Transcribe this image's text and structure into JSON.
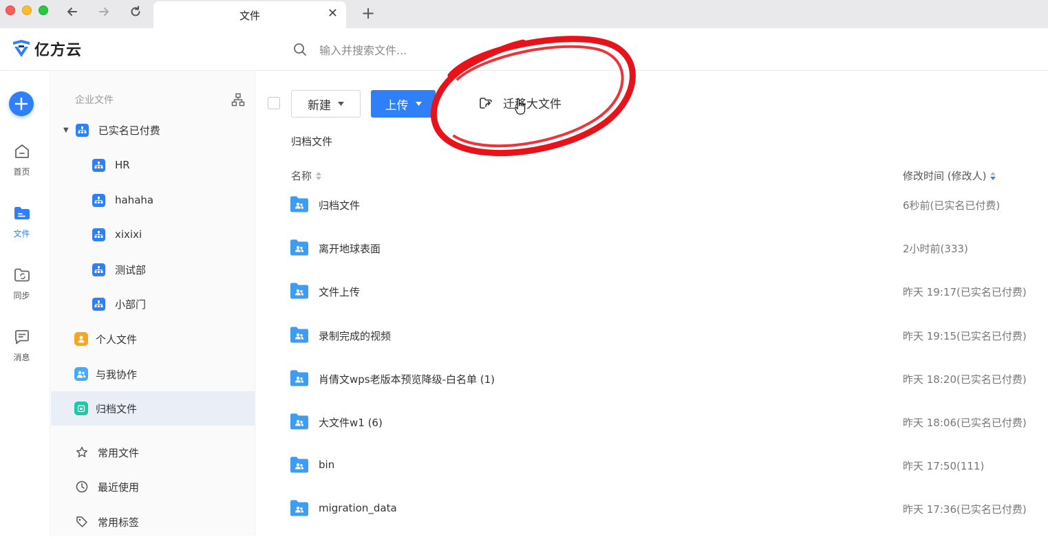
{
  "browser": {
    "tab_title": "文件",
    "close_glyph": "✕",
    "new_tab_glyph": "+"
  },
  "header": {
    "logo_text": "亿方云",
    "search_placeholder": "输入并搜索文件..."
  },
  "rail": {
    "items": [
      {
        "label": "首页",
        "icon": "home-icon"
      },
      {
        "label": "文件",
        "icon": "folder-icon",
        "active": true
      },
      {
        "label": "同步",
        "icon": "sync-folder-icon"
      },
      {
        "label": "消息",
        "icon": "message-icon"
      }
    ]
  },
  "tree": {
    "heading": "企业文件",
    "root": "已实名已付费",
    "departments": [
      "HR",
      "hahaha",
      "xixixi",
      "测试部",
      "小部门"
    ],
    "personal": "个人文件",
    "shared": "与我协作",
    "archive": "归档文件",
    "favorites": "常用文件",
    "recent": "最近使用",
    "tags": "常用标签"
  },
  "toolbar": {
    "new_label": "新建",
    "upload_label": "上传",
    "migrate_label": "迁移大文件"
  },
  "breadcrumb": "归档文件",
  "columns": {
    "name": "名称",
    "modified": "修改时间 (修改人)"
  },
  "files": [
    {
      "name": "归档文件",
      "modified": "6秒前(已实名已付费)"
    },
    {
      "name": "离开地球表面",
      "modified": "2小时前(333)"
    },
    {
      "name": "文件上传",
      "modified": "昨天 19:17(已实名已付费)"
    },
    {
      "name": "录制完成的视频",
      "modified": "昨天 19:15(已实名已付费)"
    },
    {
      "name": "肖倩文wps老版本预览降级-白名单 (1)",
      "modified": "昨天 18:20(已实名已付费)"
    },
    {
      "name": "大文件w1 (6)",
      "modified": "昨天 18:06(已实名已付费)"
    },
    {
      "name": "bin",
      "modified": "昨天 17:50(111)"
    },
    {
      "name": "migration_data",
      "modified": "昨天 17:36(已实名已付费)"
    }
  ],
  "colors": {
    "accent": "#2f7ff6",
    "annotation": "#e8121b",
    "folder": "#3d9df2"
  }
}
